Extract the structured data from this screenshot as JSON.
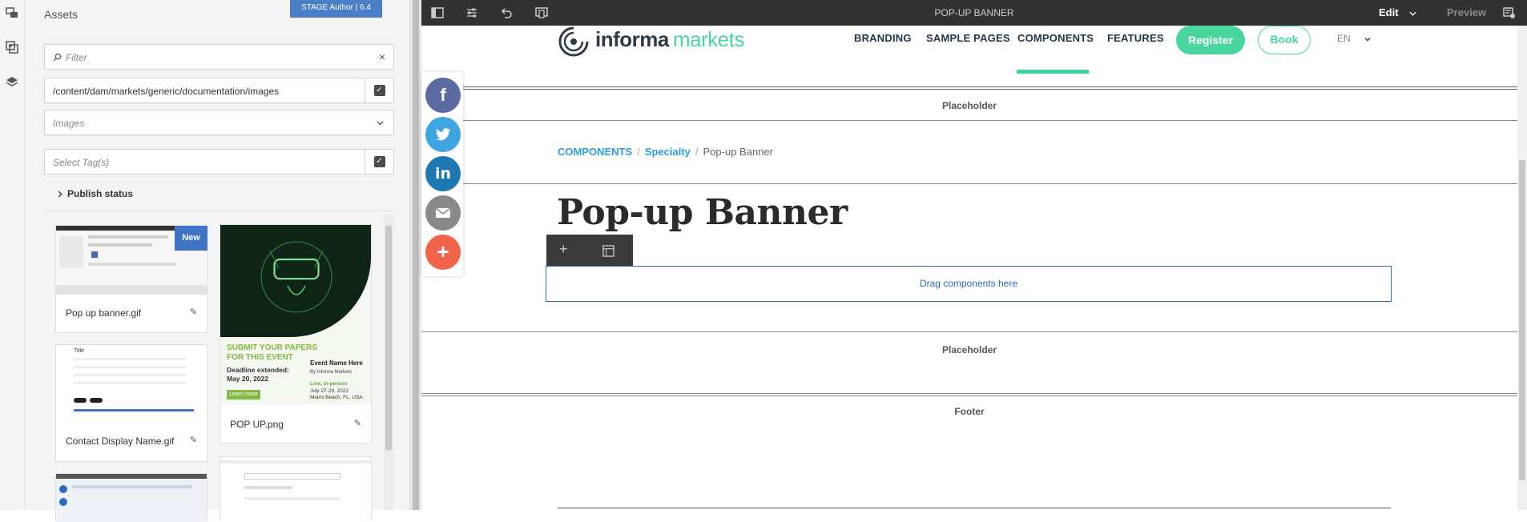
{
  "panel": {
    "title": "Assets",
    "stage_badge": "STAGE Author | 6.4",
    "filter_placeholder": "Filter",
    "path_value": "/content/dam/markets/generic/documentation/images",
    "type_value": "Images",
    "tags_placeholder": "Select Tag(s)",
    "publish_status": "Publish status"
  },
  "assets": [
    {
      "name": "Pop up banner.gif",
      "badge": "New"
    },
    {
      "name": "POP UP.png",
      "thumb": {
        "headline1": "SUBMIT YOUR PAPERS",
        "headline2": "FOR THIS EVENT",
        "deadline1": "Deadline extended:",
        "deadline2": "May 20, 2022",
        "button": "Learn more",
        "event": "Event Name Here",
        "by": "By Informa Markets",
        "live": "Live, in-person",
        "dates": "July 27-29, 2022",
        "place": "Miami Beach, FL, USA"
      }
    },
    {
      "name": "Contact Display Name.gif"
    }
  ],
  "toolbar": {
    "title": "POP-UP BANNER",
    "edit": "Edit",
    "preview": "Preview"
  },
  "site": {
    "logo_word1": "informa",
    "logo_word2": "markets",
    "nav": [
      "BRANDING",
      "SAMPLE PAGES",
      "COMPONENTS",
      "FEATURES"
    ],
    "register": "Register",
    "book": "Book",
    "lang": "EN"
  },
  "page": {
    "placeholder1": "Placeholder",
    "breadcrumb": [
      "COMPONENTS",
      "Specialty",
      "Pop-up Banner"
    ],
    "heading": "Pop-up Banner",
    "drag": "Drag components here",
    "placeholder2": "Placeholder",
    "footer": "Footer"
  },
  "colors": {
    "accent_green": "#49d69e",
    "link_blue": "#2b9fd9",
    "facebook": "#5b6aa1",
    "twitter": "#3fa5e0",
    "linkedin": "#1d78b4",
    "email": "#8a8a8a",
    "share": "#f2634c"
  }
}
